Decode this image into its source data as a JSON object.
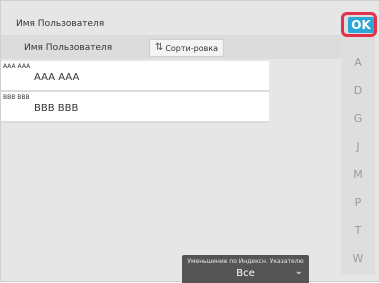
{
  "screen": {
    "title": "Имя Пользователя",
    "column_label": "Имя Пользователя",
    "sort_button_label": "Сорти-ровка",
    "ok_label": "OK"
  },
  "list": {
    "items": [
      {
        "small": "AAA AAA",
        "main": "AAA AAA"
      },
      {
        "small": "BBB BBB",
        "main": "BBB BBB"
      }
    ]
  },
  "index": {
    "letters": [
      "A",
      "D",
      "G",
      "J",
      "M",
      "P",
      "T",
      "W"
    ]
  },
  "bottom": {
    "caption": "Уменьшение по Индексн. Указателю",
    "value": "Все"
  },
  "colors": {
    "ok_bg": "#2aa7d6",
    "ok_outline": "#e2324b",
    "index_text": "#9a9a9a"
  },
  "icons": {
    "sort": "sort-arrows-icon",
    "dropdown": "chevron-down-icon"
  }
}
